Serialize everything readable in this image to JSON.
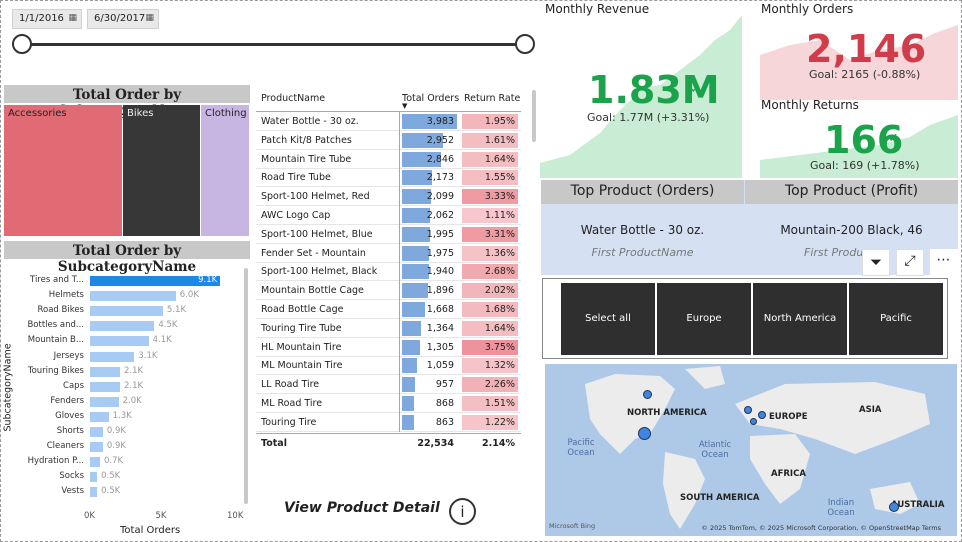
{
  "slicer": {
    "start_date": "1/1/2016",
    "end_date": "6/30/2017"
  },
  "treemap": {
    "title": "Total Order by SubcategoryName",
    "items": [
      {
        "label": "Accessories",
        "color": "#e06b74"
      },
      {
        "label": "Bikes",
        "color": "#373737"
      },
      {
        "label": "Clothing",
        "color": "#c8b6e2"
      }
    ]
  },
  "bar_chart_title": "Total Order by SubcategoryName",
  "chart_data": {
    "type": "bar",
    "orientation": "horizontal",
    "title": "Total Order by SubcategoryName",
    "xlabel": "Total Orders",
    "ylabel": "SubcategoryName",
    "categories": [
      "Tires and T...",
      "Helmets",
      "Road Bikes",
      "Bottles and...",
      "Mountain B...",
      "Jerseys",
      "Touring Bikes",
      "Caps",
      "Fenders",
      "Gloves",
      "Shorts",
      "Cleaners",
      "Hydration P...",
      "Socks",
      "Vests"
    ],
    "values": [
      9100,
      6000,
      5100,
      4500,
      4100,
      3100,
      2100,
      2100,
      2000,
      1300,
      900,
      900,
      700,
      500,
      500
    ],
    "value_labels": [
      "9.1K",
      "6.0K",
      "5.1K",
      "4.5K",
      "4.1K",
      "3.1K",
      "2.1K",
      "2.1K",
      "2.0K",
      "1.3K",
      "0.9K",
      "0.9K",
      "0.7K",
      "0.5K",
      "0.5K"
    ],
    "x_ticks": [
      "0K",
      "5K",
      "10K"
    ],
    "xlim": [
      0,
      10000
    ]
  },
  "table": {
    "headers": {
      "name": "ProductName",
      "orders": "Total Orders",
      "return": "Return Rate"
    },
    "rows": [
      {
        "name": "Water Bottle - 30 oz.",
        "orders": "3,983",
        "orders_val": 3983,
        "return": "1.95%",
        "return_val": 1.95
      },
      {
        "name": "Patch Kit/8 Patches",
        "orders": "2,952",
        "orders_val": 2952,
        "return": "1.61%",
        "return_val": 1.61
      },
      {
        "name": "Mountain Tire Tube",
        "orders": "2,846",
        "orders_val": 2846,
        "return": "1.64%",
        "return_val": 1.64
      },
      {
        "name": "Road Tire Tube",
        "orders": "2,173",
        "orders_val": 2173,
        "return": "1.55%",
        "return_val": 1.55
      },
      {
        "name": "Sport-100 Helmet, Red",
        "orders": "2,099",
        "orders_val": 2099,
        "return": "3.33%",
        "return_val": 3.33
      },
      {
        "name": "AWC Logo Cap",
        "orders": "2,062",
        "orders_val": 2062,
        "return": "1.11%",
        "return_val": 1.11
      },
      {
        "name": "Sport-100 Helmet, Blue",
        "orders": "1,995",
        "orders_val": 1995,
        "return": "3.31%",
        "return_val": 3.31
      },
      {
        "name": "Fender Set - Mountain",
        "orders": "1,975",
        "orders_val": 1975,
        "return": "1.36%",
        "return_val": 1.36
      },
      {
        "name": "Sport-100 Helmet, Black",
        "orders": "1,940",
        "orders_val": 1940,
        "return": "2.68%",
        "return_val": 2.68
      },
      {
        "name": "Mountain Bottle Cage",
        "orders": "1,896",
        "orders_val": 1896,
        "return": "2.02%",
        "return_val": 2.02
      },
      {
        "name": "Road Bottle Cage",
        "orders": "1,668",
        "orders_val": 1668,
        "return": "1.68%",
        "return_val": 1.68
      },
      {
        "name": "Touring Tire Tube",
        "orders": "1,364",
        "orders_val": 1364,
        "return": "1.64%",
        "return_val": 1.64
      },
      {
        "name": "HL Mountain Tire",
        "orders": "1,305",
        "orders_val": 1305,
        "return": "3.75%",
        "return_val": 3.75
      },
      {
        "name": "ML Mountain Tire",
        "orders": "1,059",
        "orders_val": 1059,
        "return": "1.32%",
        "return_val": 1.32
      },
      {
        "name": "LL Road Tire",
        "orders": "957",
        "orders_val": 957,
        "return": "2.26%",
        "return_val": 2.26
      },
      {
        "name": "ML Road Tire",
        "orders": "868",
        "orders_val": 868,
        "return": "1.51%",
        "return_val": 1.51
      },
      {
        "name": "Touring Tire",
        "orders": "863",
        "orders_val": 863,
        "return": "1.22%",
        "return_val": 1.22
      }
    ],
    "total": {
      "label": "Total",
      "orders": "22,534",
      "return": "2.14%"
    }
  },
  "view_detail": {
    "label": "View Product Detail",
    "icon": "info-icon"
  },
  "kpis": {
    "revenue": {
      "title": "Monthly Revenue",
      "value": "1.83M",
      "goal": "Goal: 1.77M (+3.31%)",
      "color": "#1aa34a"
    },
    "orders": {
      "title": "Monthly Orders",
      "value": "2,146",
      "goal": "Goal: 2165 (-0.88%)",
      "color": "#d13c4b"
    },
    "returns": {
      "title": "Monthly Returns",
      "value": "166",
      "goal": "Goal: 169 (+1.78%)",
      "color": "#1aa34a"
    }
  },
  "top_products": {
    "orders_title": "Top Product (Orders)",
    "profit_title": "Top Product (Profit)",
    "orders_value": "Water Bottle - 30 oz.",
    "profit_value": "Mountain-200 Black, 46",
    "subtitle": "First ProductName",
    "subtitle_profit": "First Produ"
  },
  "regions": [
    "Select all",
    "Europe",
    "North America",
    "Pacific"
  ],
  "map": {
    "labels": [
      "NORTH AMERICA",
      "EUROPE",
      "ASIA",
      "AFRICA",
      "SOUTH AMERICA",
      "AUSTRALIA"
    ],
    "oceans": [
      "Pacific Ocean",
      "Atlantic Ocean",
      "Indian Ocean"
    ],
    "attribution": "© 2025 TomTom, © 2025 Microsoft Corporation, © OpenStreetMap  Terms",
    "brand": "Microsoft Bing"
  }
}
